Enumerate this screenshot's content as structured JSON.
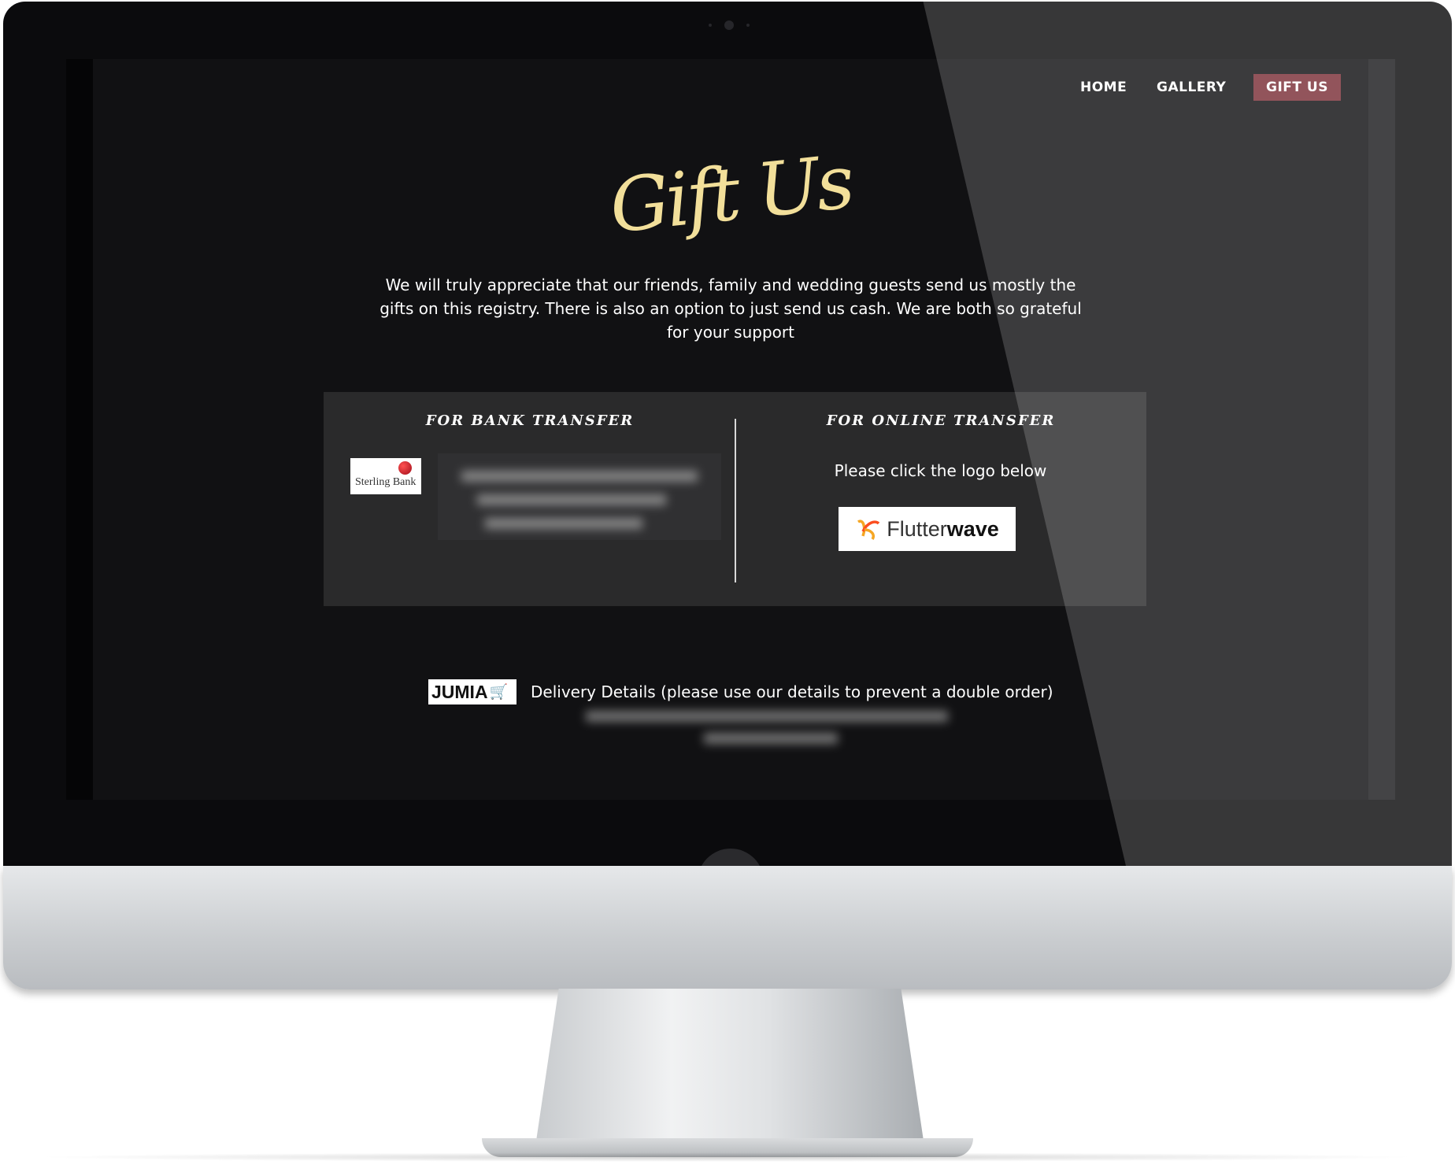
{
  "nav": {
    "items": [
      "HOME",
      "GALLERY",
      "GIFT US"
    ],
    "active_item": "GIFT US",
    "active_color": "#7a2f38"
  },
  "page": {
    "title": "Gift Us",
    "title_color": "#f2df9a",
    "intro": "We will truly appreciate that our friends, family and wedding guests send us mostly the gifts on this registry. There is also an option to just send us cash. We are both so grateful for your support"
  },
  "bank_transfer": {
    "heading": "FOR BANK TRANSFER",
    "bank_logo_text": "Sterling Bank"
  },
  "online_transfer": {
    "heading": "FOR ONLINE TRANSFER",
    "instruction": "Please click the logo below",
    "logo_text_light": "Flutter",
    "logo_text_bold": "wave"
  },
  "delivery": {
    "logo_text": "JUMIA",
    "text": "Delivery Details (please use our details to prevent a double order)"
  },
  "icons": [
    "sterling-bank-logo-icon",
    "flutterwave-logo-icon",
    "jumia-logo-icon",
    "cart-icon"
  ]
}
